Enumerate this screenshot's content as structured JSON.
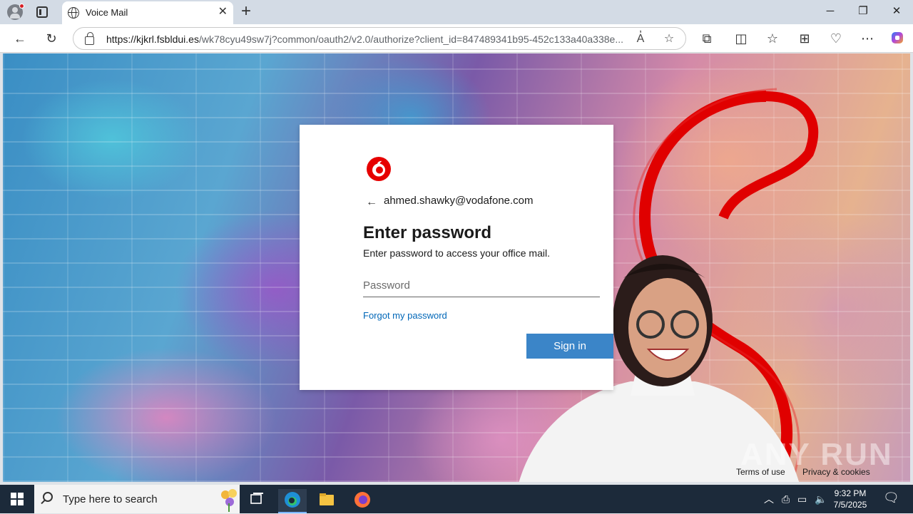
{
  "browser": {
    "tab_title": "Voice Mail",
    "url_domain": "https://kjkrl.fsbldui.es",
    "url_path": "/wk78cyu49sw7j?common/oauth2/v2.0/authorize?client_id=847489341b95-452c133a40a338e..."
  },
  "login": {
    "brand": "Vodafone",
    "email": "ahmed.shawky@vodafone.com",
    "heading": "Enter password",
    "subtext": "Enter password to access your office mail.",
    "password_placeholder": "Password",
    "forgot_label": "Forgot my password",
    "signin_label": "Sign in",
    "brand_color": "#e60000",
    "button_color": "#3b85c8"
  },
  "footer": {
    "terms": "Terms of use",
    "privacy": "Privacy & cookies"
  },
  "watermark": "ANY RUN",
  "taskbar": {
    "search_placeholder": "Type here to search",
    "time": "9:32 PM",
    "date": "7/5/2025"
  }
}
